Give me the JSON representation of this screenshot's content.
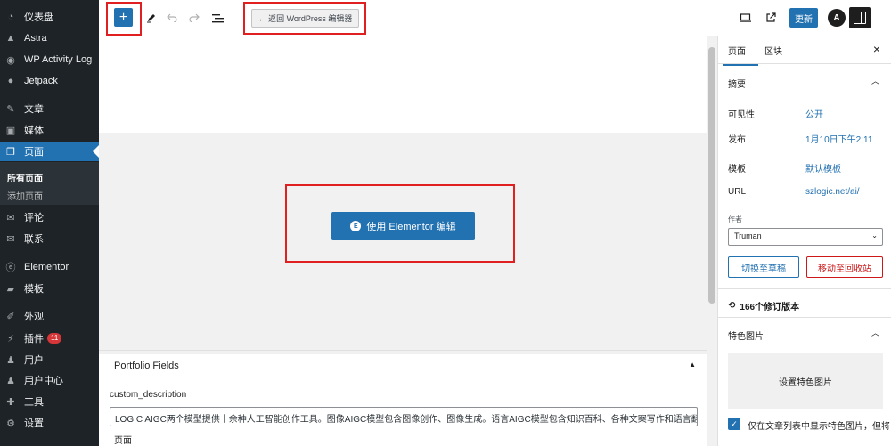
{
  "sidebar": {
    "items": [
      {
        "label": "仪表盘",
        "icon": "dashboard-icon"
      },
      {
        "label": "Astra",
        "icon": "astra-icon"
      },
      {
        "label": "WP Activity Log",
        "icon": "activity-log-icon"
      },
      {
        "label": "Jetpack",
        "icon": "jetpack-icon"
      },
      {
        "label": "文章",
        "icon": "pin-icon"
      },
      {
        "label": "媒体",
        "icon": "media-icon"
      },
      {
        "label": "页面",
        "icon": "pages-icon"
      },
      {
        "label": "评论",
        "icon": "comments-icon"
      },
      {
        "label": "联系",
        "icon": "mail-icon"
      },
      {
        "label": "Elementor",
        "icon": "elementor-icon"
      },
      {
        "label": "模板",
        "icon": "folder-icon"
      },
      {
        "label": "外观",
        "icon": "brush-icon"
      },
      {
        "label": "插件",
        "icon": "plugin-icon"
      },
      {
        "label": "用户",
        "icon": "user-icon"
      },
      {
        "label": "用户中心",
        "icon": "user-center-icon"
      },
      {
        "label": "工具",
        "icon": "wrench-icon"
      },
      {
        "label": "设置",
        "icon": "settings-icon"
      }
    ],
    "plugin_badge": "11",
    "submenu": {
      "all_pages": "所有页面",
      "add_page": "添加页面"
    }
  },
  "toolbar": {
    "add_label": "+",
    "back_label": "← 返回 WordPress 编辑器",
    "update_label": "更新",
    "astra_label": "A"
  },
  "canvas": {
    "elementor_button": "使用 Elementor 编辑",
    "elementor_icon_label": "E"
  },
  "metabox": {
    "title": "Portfolio Fields",
    "field_label": "custom_description",
    "field_value": "LOGIC AIGC两个模型提供十余种人工智能创作工具。图像AIGC模型包含图像创作、图像生成。语言AIGC模型包含知识百科、各种文案写作和语言翻译",
    "footer": "页面"
  },
  "panel": {
    "tabs": [
      "页面",
      "区块"
    ],
    "summary_title": "摘要",
    "rows": [
      {
        "label": "可见性",
        "value": "公开"
      },
      {
        "label": "发布",
        "value": "1月10日下午2:11"
      },
      {
        "label": "模板",
        "value": "默认模板"
      },
      {
        "label": "URL",
        "value": "szlogic.net/ai/"
      }
    ],
    "author_label": "作者",
    "author_value": "Truman",
    "draft_button": "切换至草稿",
    "trash_button": "移动至回收站",
    "revisions": "166个修订版本",
    "featured_title": "特色图片",
    "featured_button": "设置特色图片",
    "featured_checkbox": "仅在文章列表中显示特色图片，但将"
  },
  "colors": {
    "accent": "#2271b1",
    "sidebar_bg": "#1d2327",
    "highlight": "#e02020"
  }
}
